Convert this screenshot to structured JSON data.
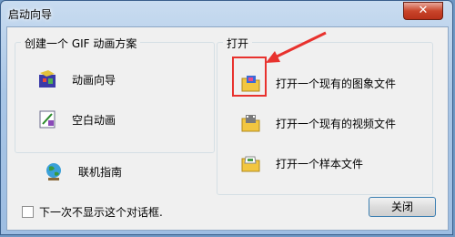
{
  "window": {
    "title": "启动向导",
    "close_glyph": "✕"
  },
  "group_create": {
    "legend": "创建一个 GIF 动画方案",
    "items": [
      {
        "label": "动画向导",
        "icon": "animation-wizard-icon"
      },
      {
        "label": "空白动画",
        "icon": "blank-animation-icon"
      }
    ]
  },
  "group_open": {
    "legend": "打开",
    "items": [
      {
        "label": "打开一个现有的图象文件",
        "icon": "image-folder-icon"
      },
      {
        "label": "打开一个现有的视频文件",
        "icon": "video-folder-icon"
      },
      {
        "label": "打开一个样本文件",
        "icon": "sample-folder-icon"
      }
    ]
  },
  "online_guide": {
    "label": "联机指南",
    "icon": "globe-icon"
  },
  "checkbox": {
    "label": "下一次不显示这个对话框.",
    "checked": false
  },
  "buttons": {
    "close_label": "关闭"
  },
  "colors": {
    "annotation": "#e8322e",
    "title_gradient_top": "#c9dcf0"
  }
}
